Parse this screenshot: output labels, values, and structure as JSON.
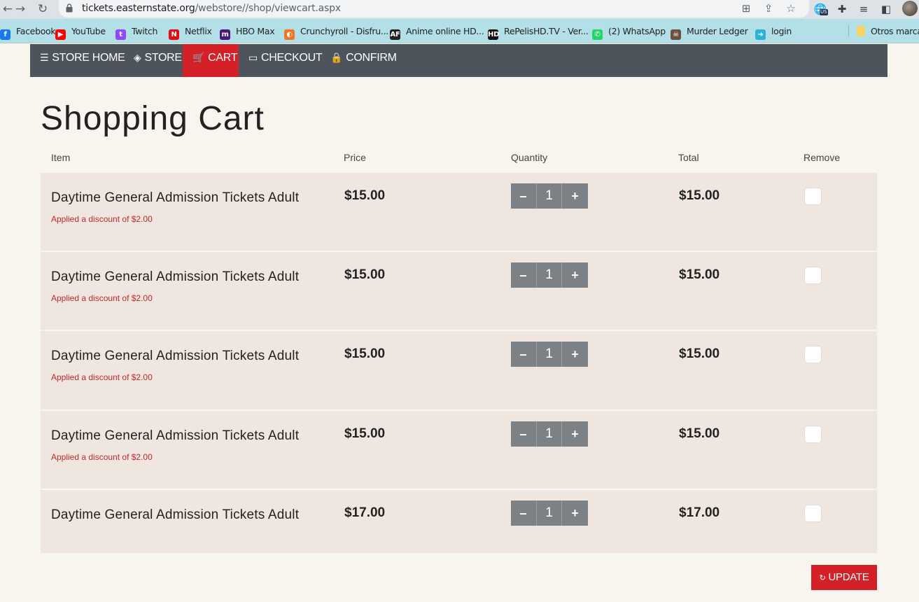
{
  "browser": {
    "url_host": "tickets.easternstate.org",
    "url_path": "/webstore//shop/viewcart.aspx",
    "profile_badge": "US",
    "bookmarks": [
      {
        "label": "Facebook",
        "icon": "facebook-icon",
        "color": "#1877f2"
      },
      {
        "label": "YouTube",
        "icon": "youtube-icon",
        "color": "#ff0000"
      },
      {
        "label": "Twitch",
        "icon": "twitch-icon",
        "color": "#9146ff"
      },
      {
        "label": "Netflix",
        "icon": "netflix-icon",
        "color": "#e50914"
      },
      {
        "label": "HBO Max",
        "icon": "hbomax-icon",
        "color": "#4b1a7a"
      },
      {
        "label": "Crunchyroll - Disfru...",
        "icon": "crunchyroll-icon",
        "color": "#f47521"
      },
      {
        "label": "Anime online HD...",
        "icon": "animeflv-icon",
        "color": "#222222"
      },
      {
        "label": "RePelisHD.TV - Ver...",
        "icon": "repelis-icon",
        "color": "#111111"
      },
      {
        "label": "(2) WhatsApp",
        "icon": "whatsapp-icon",
        "color": "#25d366"
      },
      {
        "label": "Murder Ledger",
        "icon": "murder-ledger-icon",
        "color": "#6b4e3d"
      },
      {
        "label": "login",
        "icon": "login-icon",
        "color": "#2bb3d6"
      }
    ],
    "other_bookmarks": "Otros marca"
  },
  "store_nav": [
    {
      "label": "STORE HOME",
      "icon": "menu-icon",
      "active": false
    },
    {
      "label": "STORE",
      "icon": "tag-icon",
      "active": false
    },
    {
      "label": "CART",
      "icon": "cart-icon",
      "active": true
    },
    {
      "label": "CHECKOUT",
      "icon": "credit-card-icon",
      "active": false
    },
    {
      "label": "CONFIRM",
      "icon": "lock-icon",
      "active": false
    }
  ],
  "page": {
    "title": "Shopping Cart"
  },
  "table": {
    "headers": {
      "item": "Item",
      "price": "Price",
      "quantity": "Quantity",
      "total": "Total",
      "remove": "Remove"
    },
    "rows": [
      {
        "name": "Daytime General Admission Tickets Adult",
        "discount": "Applied a discount of $2.00",
        "price": "$15.00",
        "quantity": "1",
        "total": "$15.00",
        "remove_checked": false
      },
      {
        "name": "Daytime General Admission Tickets Adult",
        "discount": "Applied a discount of $2.00",
        "price": "$15.00",
        "quantity": "1",
        "total": "$15.00",
        "remove_checked": false
      },
      {
        "name": "Daytime General Admission Tickets Adult",
        "discount": "Applied a discount of $2.00",
        "price": "$15.00",
        "quantity": "1",
        "total": "$15.00",
        "remove_checked": false
      },
      {
        "name": "Daytime General Admission Tickets Adult",
        "discount": "Applied a discount of $2.00",
        "price": "$15.00",
        "quantity": "1",
        "total": "$15.00",
        "remove_checked": false
      },
      {
        "name": "Daytime General Admission Tickets Adult",
        "discount": "",
        "price": "$17.00",
        "quantity": "1",
        "total": "$17.00",
        "remove_checked": false
      }
    ],
    "decrement_label": "–",
    "increment_label": "+"
  },
  "update_button": {
    "label": "UPDATE",
    "icon": "refresh-icon"
  },
  "colors": {
    "accent": "#d42127",
    "nav_bg": "#4e545b",
    "row_bg": "#efe7df",
    "page_bg": "#f8f4ee",
    "discount_text": "#c1272d",
    "bookmarks_bar": "#b3e0e7"
  }
}
